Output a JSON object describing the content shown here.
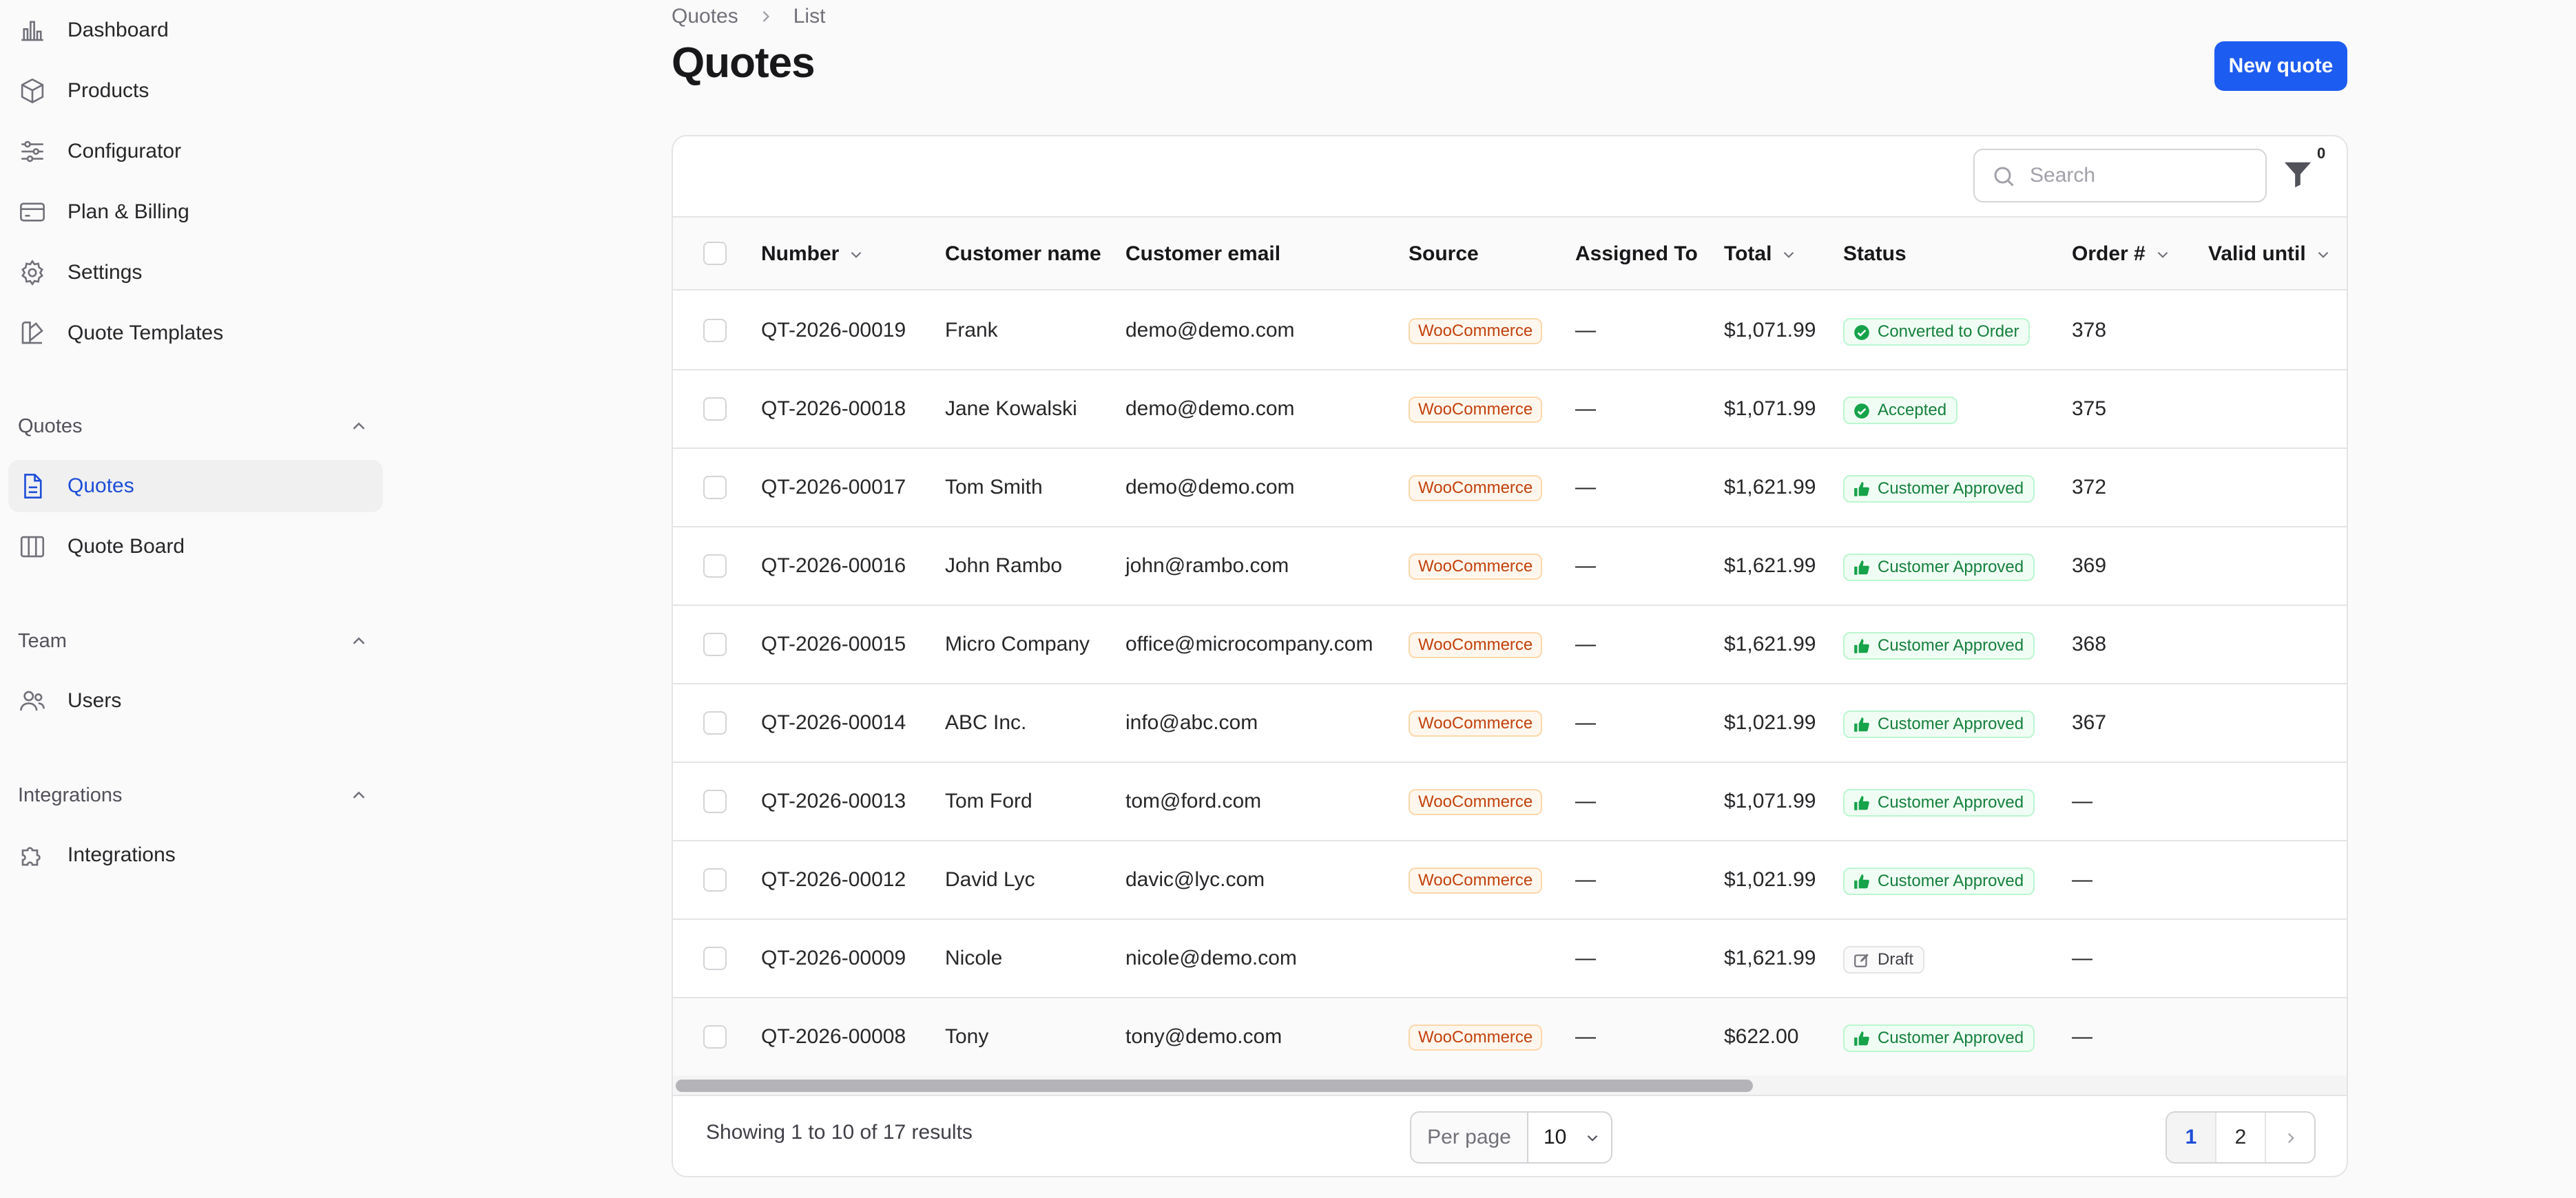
{
  "sidebar": {
    "items": [
      {
        "label": "Dashboard",
        "icon": "chart-bar-icon"
      },
      {
        "label": "Products",
        "icon": "cube-icon"
      },
      {
        "label": "Configurator",
        "icon": "sliders-icon"
      },
      {
        "label": "Plan & Billing",
        "icon": "credit-card-icon"
      },
      {
        "label": "Settings",
        "icon": "gear-icon"
      },
      {
        "label": "Quote Templates",
        "icon": "template-icon"
      }
    ],
    "groups": {
      "quotes": {
        "label": "Quotes",
        "items": [
          {
            "label": "Quotes",
            "icon": "document-icon"
          },
          {
            "label": "Quote Board",
            "icon": "columns-icon"
          }
        ]
      },
      "team": {
        "label": "Team",
        "items": [
          {
            "label": "Users",
            "icon": "users-icon"
          }
        ]
      },
      "integrations": {
        "label": "Integrations",
        "items": [
          {
            "label": "Integrations",
            "icon": "puzzle-icon"
          }
        ]
      }
    }
  },
  "header": {
    "breadcrumb": [
      "Quotes",
      "List"
    ],
    "title": "Quotes",
    "new_button": "New quote"
  },
  "toolbar": {
    "search_placeholder": "Search",
    "filter_count": "0"
  },
  "table": {
    "columns": {
      "number": "Number",
      "customer_name": "Customer name",
      "customer_email": "Customer email",
      "source": "Source",
      "assigned_to": "Assigned To",
      "total": "Total",
      "status": "Status",
      "order": "Order #",
      "valid_until": "Valid until"
    },
    "rows": [
      {
        "number": "QT-2026-00019",
        "name": "Frank",
        "email": "demo@demo.com",
        "source": "WooCommerce",
        "assigned": "—",
        "total": "$1,071.99",
        "status": "Converted to Order",
        "status_icon": "check-circle-icon",
        "order": "378",
        "valid": ""
      },
      {
        "number": "QT-2026-00018",
        "name": "Jane Kowalski",
        "email": "demo@demo.com",
        "source": "WooCommerce",
        "assigned": "—",
        "total": "$1,071.99",
        "status": "Accepted",
        "status_icon": "check-circle-icon",
        "order": "375",
        "valid": ""
      },
      {
        "number": "QT-2026-00017",
        "name": "Tom Smith",
        "email": "demo@demo.com",
        "source": "WooCommerce",
        "assigned": "—",
        "total": "$1,621.99",
        "status": "Customer Approved",
        "status_icon": "thumbs-up-icon",
        "order": "372",
        "valid": ""
      },
      {
        "number": "QT-2026-00016",
        "name": "John Rambo",
        "email": "john@rambo.com",
        "source": "WooCommerce",
        "assigned": "—",
        "total": "$1,621.99",
        "status": "Customer Approved",
        "status_icon": "thumbs-up-icon",
        "order": "369",
        "valid": ""
      },
      {
        "number": "QT-2026-00015",
        "name": "Micro Company",
        "email": "office@microcompany.com",
        "source": "WooCommerce",
        "assigned": "—",
        "total": "$1,621.99",
        "status": "Customer Approved",
        "status_icon": "thumbs-up-icon",
        "order": "368",
        "valid": ""
      },
      {
        "number": "QT-2026-00014",
        "name": "ABC Inc.",
        "email": "info@abc.com",
        "source": "WooCommerce",
        "assigned": "—",
        "total": "$1,021.99",
        "status": "Customer Approved",
        "status_icon": "thumbs-up-icon",
        "order": "367",
        "valid": ""
      },
      {
        "number": "QT-2026-00013",
        "name": "Tom Ford",
        "email": "tom@ford.com",
        "source": "WooCommerce",
        "assigned": "—",
        "total": "$1,071.99",
        "status": "Customer Approved",
        "status_icon": "thumbs-up-icon",
        "order": "—",
        "valid": ""
      },
      {
        "number": "QT-2026-00012",
        "name": "David Lyc",
        "email": "davic@lyc.com",
        "source": "WooCommerce",
        "assigned": "—",
        "total": "$1,021.99",
        "status": "Customer Approved",
        "status_icon": "thumbs-up-icon",
        "order": "—",
        "valid": ""
      },
      {
        "number": "QT-2026-00009",
        "name": "Nicole",
        "email": "nicole@demo.com",
        "source": "",
        "assigned": "—",
        "total": "$1,621.99",
        "status": "Draft",
        "status_icon": "pencil-square-icon",
        "order": "—",
        "valid": ""
      },
      {
        "number": "QT-2026-00008",
        "name": "Tony",
        "email": "tony@demo.com",
        "source": "WooCommerce",
        "assigned": "—",
        "total": "$622.00",
        "status": "Customer Approved",
        "status_icon": "thumbs-up-icon",
        "order": "—",
        "valid": ""
      }
    ]
  },
  "footer": {
    "showing": "Showing 1 to 10 of 17 results",
    "per_page_label": "Per page",
    "per_page_value": "10",
    "pages": [
      "1",
      "2"
    ],
    "current_page": "1"
  },
  "colors": {
    "accent": "#1d5cf0",
    "active_nav": "#1d4ed8",
    "status_green": "#15803d",
    "source_orange": "#c2410c"
  }
}
